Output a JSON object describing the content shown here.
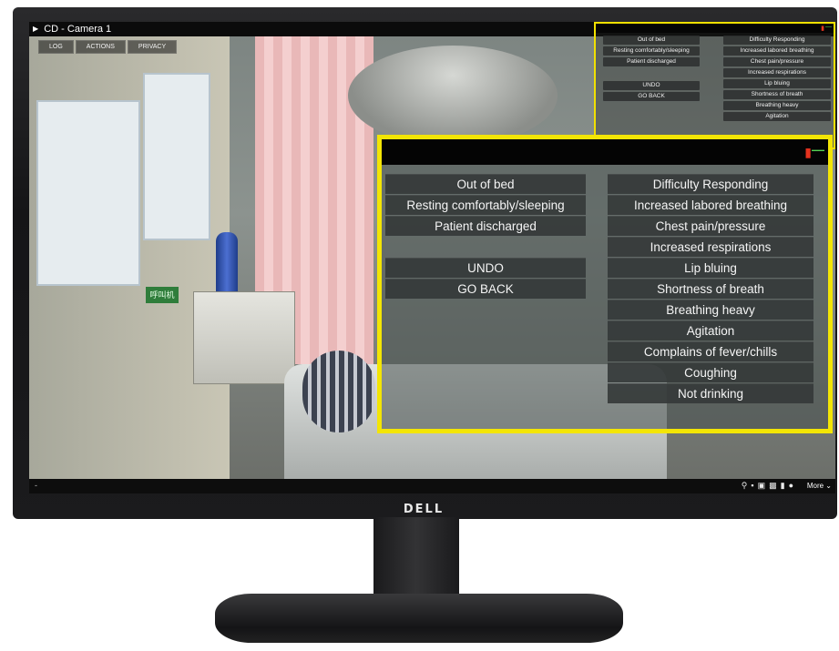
{
  "window": {
    "title": "CD - Camera 1"
  },
  "menu_tabs": [
    "LOG",
    "ACTIONS",
    "PRIVACY"
  ],
  "monitor_brand": "DELL",
  "scene_sign": "呼叫机",
  "overlay": {
    "left_column": [
      "Out of bed",
      "Resting comfortably/sleeping",
      "Patient discharged",
      "",
      "UNDO",
      "GO BACK"
    ],
    "right_column": [
      "Difficulty Responding",
      "Increased labored breathing",
      "Chest pain/pressure",
      "Increased respirations",
      "Lip bluing",
      "Shortness of breath",
      "Breathing heavy",
      "Agitation",
      "Complains of fever/chills",
      "Coughing",
      "Not drinking"
    ],
    "small_right_column_visible": [
      "Difficulty Responding",
      "Increased labored breathing",
      "Chest pain/pressure",
      "Increased respirations",
      "Lip bluing",
      "Shortness of breath",
      "Breathing heavy",
      "Agitation"
    ],
    "highlight_color": "#f3e505",
    "alert_icon": "speaker-muted-icon",
    "close_icon": "minimize-icon"
  },
  "bottom_bar": {
    "left": "-",
    "tools": [
      "zoom-icon",
      "video-icon",
      "snapshot-icon",
      "print-icon",
      "lock-icon",
      "record-icon"
    ],
    "more_label": "More"
  }
}
